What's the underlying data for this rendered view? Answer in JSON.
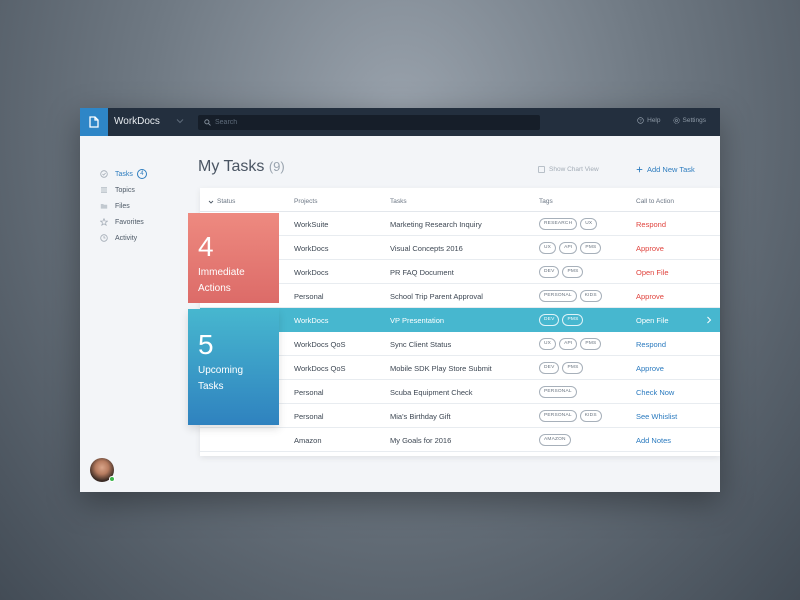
{
  "app": {
    "name": "WorkDocs",
    "search_placeholder": "Search",
    "help_label": "Help",
    "settings_label": "Settings"
  },
  "sidebar": {
    "items": [
      {
        "label": "Tasks",
        "icon": "check-circle-icon",
        "badge": "4",
        "active": true
      },
      {
        "label": "Topics",
        "icon": "list-icon"
      },
      {
        "label": "Files",
        "icon": "folder-icon"
      },
      {
        "label": "Favorites",
        "icon": "star-icon"
      },
      {
        "label": "Activity",
        "icon": "clock-icon"
      }
    ]
  },
  "main": {
    "title": "My Tasks",
    "count": "(9)",
    "chart_toggle_label": "Show Chart View",
    "add_task_label": "Add New Task"
  },
  "table": {
    "headers": {
      "status": "Status",
      "projects": "Projects",
      "tasks": "Tasks",
      "tags": "Tags",
      "cta": "Call to Action"
    },
    "rows": [
      {
        "project": "WorkSuite",
        "task": "Marketing Research Inquiry",
        "tags": [
          "RESEARCH",
          "UX"
        ],
        "cta": "Respond",
        "cta_color": "red"
      },
      {
        "project": "WorkDocs",
        "task": "Visual Concepts 2016",
        "tags": [
          "UX",
          "API",
          "PMS"
        ],
        "cta": "Approve",
        "cta_color": "red"
      },
      {
        "project": "WorkDocs",
        "task": "PR FAQ Document",
        "tags": [
          "DEV",
          "PMS"
        ],
        "cta": "Open File",
        "cta_color": "red"
      },
      {
        "project": "Personal",
        "task": "School Trip Parent Approval",
        "tags": [
          "PERSONAL",
          "KIDS"
        ],
        "cta": "Approve",
        "cta_color": "red"
      },
      {
        "project": "WorkDocs",
        "task": "VP Presentation",
        "tags": [
          "DEV",
          "PMS"
        ],
        "cta": "Open File",
        "cta_color": "blue",
        "highlight": true
      },
      {
        "project": "WorkDocs QoS",
        "task": "Sync Client Status",
        "tags": [
          "UX",
          "API",
          "PMS"
        ],
        "cta": "Respond",
        "cta_color": "blue"
      },
      {
        "project": "WorkDocs QoS",
        "task": "Mobile SDK Play Store Submit",
        "tags": [
          "DEV",
          "PMS"
        ],
        "cta": "Approve",
        "cta_color": "blue"
      },
      {
        "project": "Personal",
        "task": "Scuba Equipment Check",
        "tags": [
          "PERSONAL"
        ],
        "cta": "Check Now",
        "cta_color": "blue"
      },
      {
        "project": "Personal",
        "task": "Mia's Birthday Gift",
        "tags": [
          "PERSONAL",
          "KIDS"
        ],
        "cta": "See Whislist",
        "cta_color": "blue"
      },
      {
        "project": "Amazon",
        "task": "My Goals for 2016",
        "tags": [
          "AMAZON"
        ],
        "cta": "Add Notes",
        "cta_color": "blue"
      }
    ]
  },
  "summaries": {
    "immediate": {
      "count": "4",
      "line1": "Immediate",
      "line2": "Actions",
      "color": "#e57370"
    },
    "upcoming": {
      "count": "5",
      "line1": "Upcoming",
      "line2": "Tasks",
      "color": "#3a9fcc"
    }
  },
  "colors": {
    "accent": "#2e7dbf",
    "topbar": "#232f3e",
    "highlight_row": "#47b7cf",
    "cta_red": "#e0443e"
  }
}
